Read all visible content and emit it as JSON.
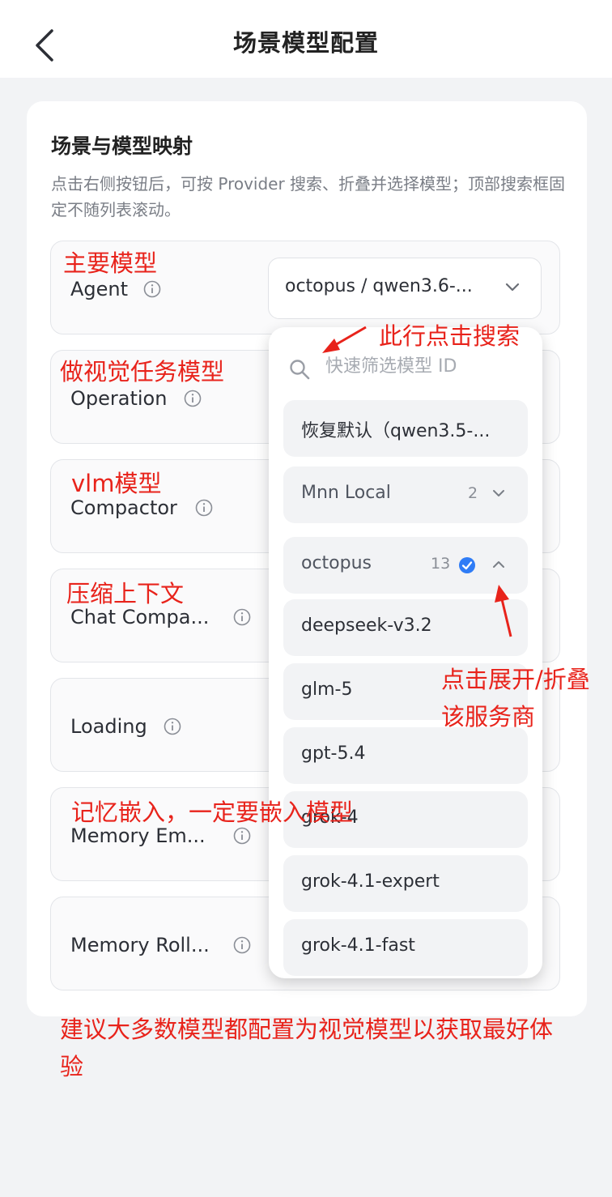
{
  "header": {
    "title": "场景模型配置",
    "back_icon": "chevron-left-icon"
  },
  "card": {
    "title": "场景与模型映射",
    "description": "点击右侧按钮后，可按 Provider 搜索、折叠并选择模型；顶部搜索框固定不随列表滚动。"
  },
  "rows": [
    {
      "label": "Agent"
    },
    {
      "label": "Operation"
    },
    {
      "label": "Compactor"
    },
    {
      "label": "Chat Compa..."
    },
    {
      "label": "Loading"
    },
    {
      "label": "Memory Em..."
    },
    {
      "label": "Memory Roll..."
    }
  ],
  "agent_select": {
    "value": "octopus / qwen3.6-..."
  },
  "dropdown": {
    "search_placeholder": "快速筛选模型 ID",
    "reset_label": "恢复默认（qwen3.5-...",
    "groups": [
      {
        "name": "Mnn Local",
        "count": "2",
        "expanded": false
      },
      {
        "name": "octopus",
        "count": "13",
        "expanded": true,
        "selected": true
      }
    ],
    "models": [
      "deepseek-v3.2",
      "glm-5",
      "gpt-5.4",
      "grok-4",
      "grok-4.1-expert",
      "grok-4.1-fast"
    ]
  },
  "annotations": {
    "main_model": "主要模型",
    "vision_model": "做视觉任务模型",
    "vlm_model": "vlm模型",
    "compress": "压缩上下文",
    "search_hint": "此行点击搜索",
    "expand_hint_line1": "点击展开/折叠",
    "expand_hint_line2": "该服务商",
    "memory_hint": "记忆嵌入，一定要嵌入模型",
    "bottom_tip": "建议大多数模型都配置为视觉模型以获取最好体验",
    "bottom_tip_line1": "建议大多数模型都配置为视觉模型以获取最好体",
    "bottom_tip_line2": "验"
  },
  "colors": {
    "accent": "#2f7cf6",
    "annotation": "#e8231b",
    "page_bg": "#f2f3f5"
  }
}
